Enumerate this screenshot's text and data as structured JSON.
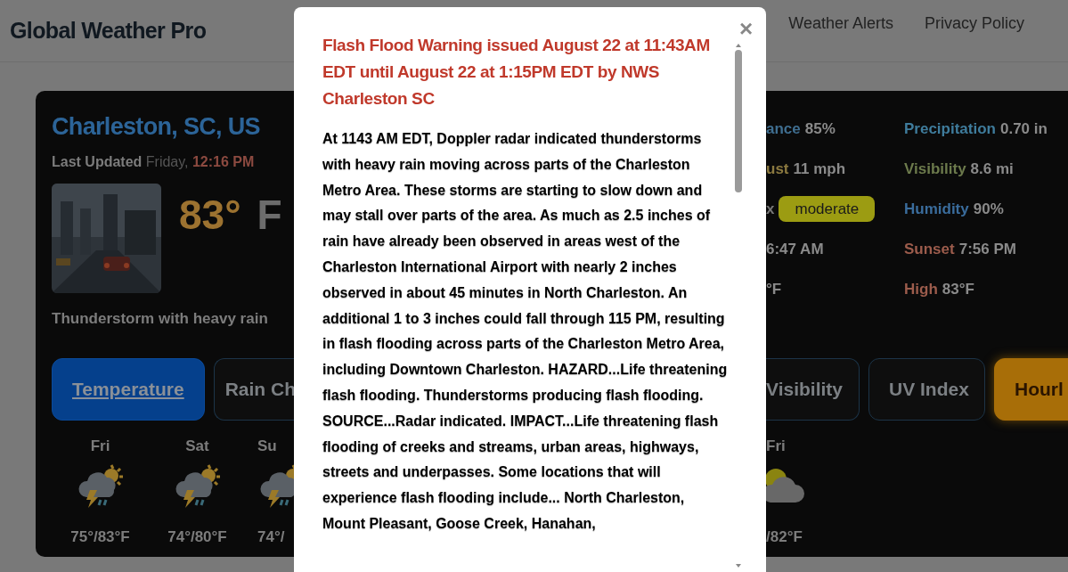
{
  "header": {
    "brand": "Global Weather Pro",
    "nav": [
      {
        "label": "Weather Alerts"
      },
      {
        "label": "Privacy Policy"
      }
    ]
  },
  "current": {
    "location": "Charleston, SC, US",
    "updated_label": "Last Updated",
    "updated_day": "Friday,",
    "updated_time": "12:16 PM",
    "temperature": "83°",
    "units": "F",
    "condition": "Thunderstorm with heavy rain"
  },
  "stats_left": [
    {
      "label": "ance",
      "value": "85%",
      "color": "#3f6e90",
      "kind": "text"
    },
    {
      "label": "ust",
      "value": "11 mph",
      "color": "#8c7a40",
      "kind": "text"
    },
    {
      "label": "x",
      "value": "moderate",
      "color": "#9c9c12",
      "kind": "badge"
    },
    {
      "value": "6:47 AM",
      "kind": "text"
    },
    {
      "value": "°F",
      "kind": "text"
    }
  ],
  "stats_right": [
    {
      "label": "Precipitation",
      "value": "0.70 in",
      "color": "#3f7c9c",
      "kind": "text"
    },
    {
      "label": "Visibility",
      "value": "8.6 mi",
      "color": "#6c7a4c",
      "kind": "text"
    },
    {
      "label": "Humidity",
      "value": "90%",
      "color": "#3a6c9c",
      "kind": "text"
    },
    {
      "label": "Sunset",
      "value": "7:56 PM",
      "color": "#9c5c4c",
      "kind": "text"
    },
    {
      "label": "High",
      "value": "83°F",
      "color": "#9c5c4c",
      "kind": "text"
    }
  ],
  "tabs_left": [
    {
      "label": "Temperature",
      "selected": true,
      "kind": "plain"
    },
    {
      "label": "Rain Ch",
      "selected": false,
      "kind": "plain"
    }
  ],
  "tabs_right": [
    {
      "label": "Visibility",
      "selected": false,
      "kind": "plain"
    },
    {
      "label": "UV Index",
      "selected": false,
      "kind": "plain"
    },
    {
      "label": "Hourl",
      "selected": false,
      "kind": "accent"
    }
  ],
  "forecast_left": [
    {
      "day": "Fri",
      "temps": "75°/83°F"
    },
    {
      "day": "Sat",
      "temps": "74°/80°F"
    },
    {
      "day": "Su",
      "temps": "74°/"
    }
  ],
  "forecast_right": [
    {
      "day": "Fri",
      "temps": "/82°F"
    }
  ],
  "alert": {
    "close": "×",
    "title": "Flash Flood Warning issued August 22 at 11:43AM EDT until August 22 at 1:15PM EDT by NWS Charleston SC",
    "body": "At 1143 AM EDT, Doppler radar indicated thunderstorms with heavy rain moving across parts of the Charleston Metro Area. These storms are starting to slow down and may stall over parts of the area. As much as 2.5 inches of rain have already been observed in areas west of the Charleston International Airport with nearly 2 inches observed in about 45 minutes in North Charleston. An additional 1 to 3 inches could fall through 115 PM, resulting in flash flooding across parts of the Charleston Metro Area, including Downtown Charleston. HAZARD...Life threatening flash flooding. Thunderstorms producing flash flooding. SOURCE...Radar indicated. IMPACT...Life threatening flash flooding of creeks and streams, urban areas, highways, streets and underpasses. Some locations that will experience flash flooding include... North Charleston, Mount Pleasant, Goose Creek, Hanahan,"
  }
}
